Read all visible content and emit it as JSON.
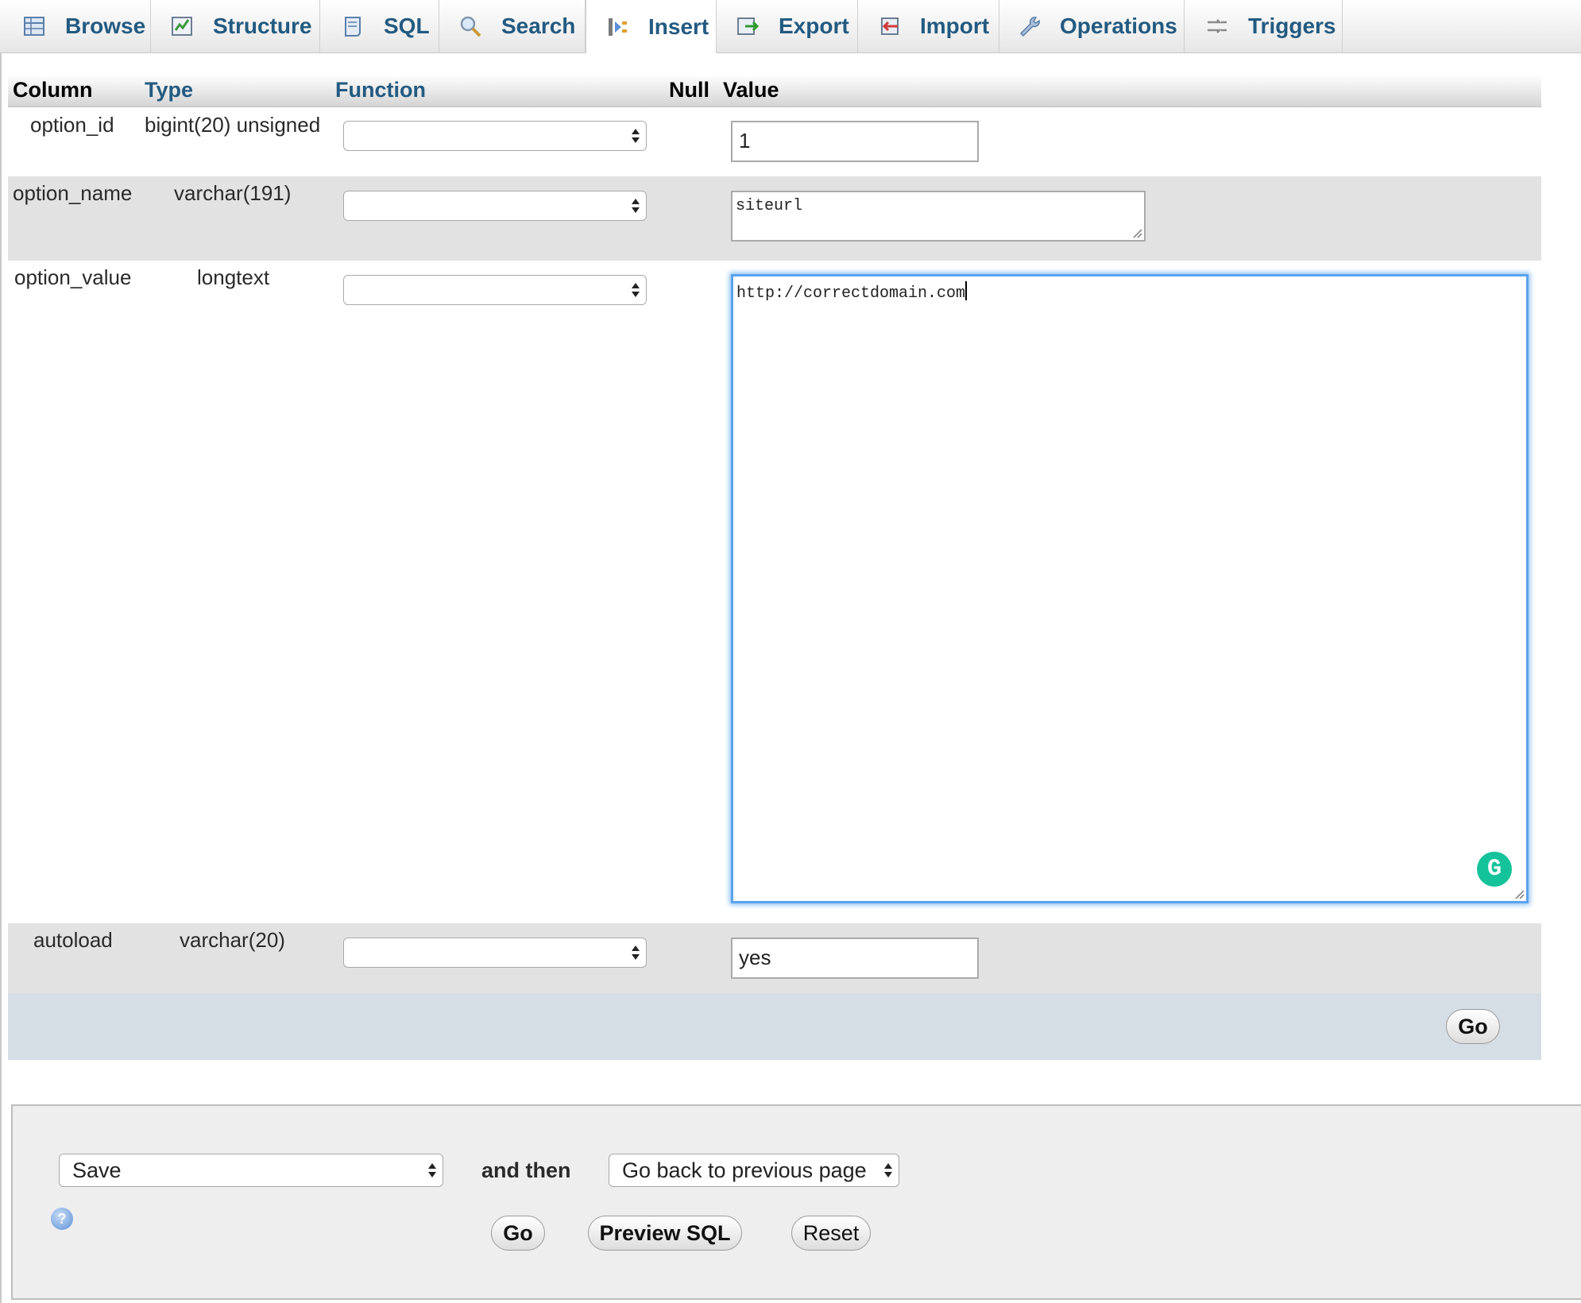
{
  "tabs": [
    {
      "label": "Browse",
      "icon": "table-icon"
    },
    {
      "label": "Structure",
      "icon": "structure-icon"
    },
    {
      "label": "SQL",
      "icon": "sql-icon"
    },
    {
      "label": "Search",
      "icon": "search-icon"
    },
    {
      "label": "Insert",
      "icon": "insert-icon",
      "active": true
    },
    {
      "label": "Export",
      "icon": "export-icon"
    },
    {
      "label": "Import",
      "icon": "import-icon"
    },
    {
      "label": "Operations",
      "icon": "wrench-icon"
    },
    {
      "label": "Triggers",
      "icon": "triggers-icon"
    }
  ],
  "table": {
    "headers": {
      "column": "Column",
      "type": "Type",
      "function": "Function",
      "null": "Null",
      "value": "Value"
    },
    "rows": [
      {
        "column": "option_id",
        "type": "bigint(20) unsigned",
        "function": "",
        "value": "1"
      },
      {
        "column": "option_name",
        "type": "varchar(191)",
        "function": "",
        "value": "siteurl"
      },
      {
        "column": "option_value",
        "type": "longtext",
        "function": "",
        "value": "http://correctdomain.com"
      },
      {
        "column": "autoload",
        "type": "varchar(20)",
        "function": "",
        "value": "yes"
      }
    ],
    "go_label": "Go"
  },
  "footer": {
    "action_select": "Save",
    "and_then": "and then",
    "after_select": "Go back to previous page",
    "go_label": "Go",
    "preview_label": "Preview SQL",
    "reset_label": "Reset"
  },
  "colors": {
    "link": "#235a81",
    "focus_border": "#5aa3ee",
    "grammarly": "#15c39a"
  }
}
